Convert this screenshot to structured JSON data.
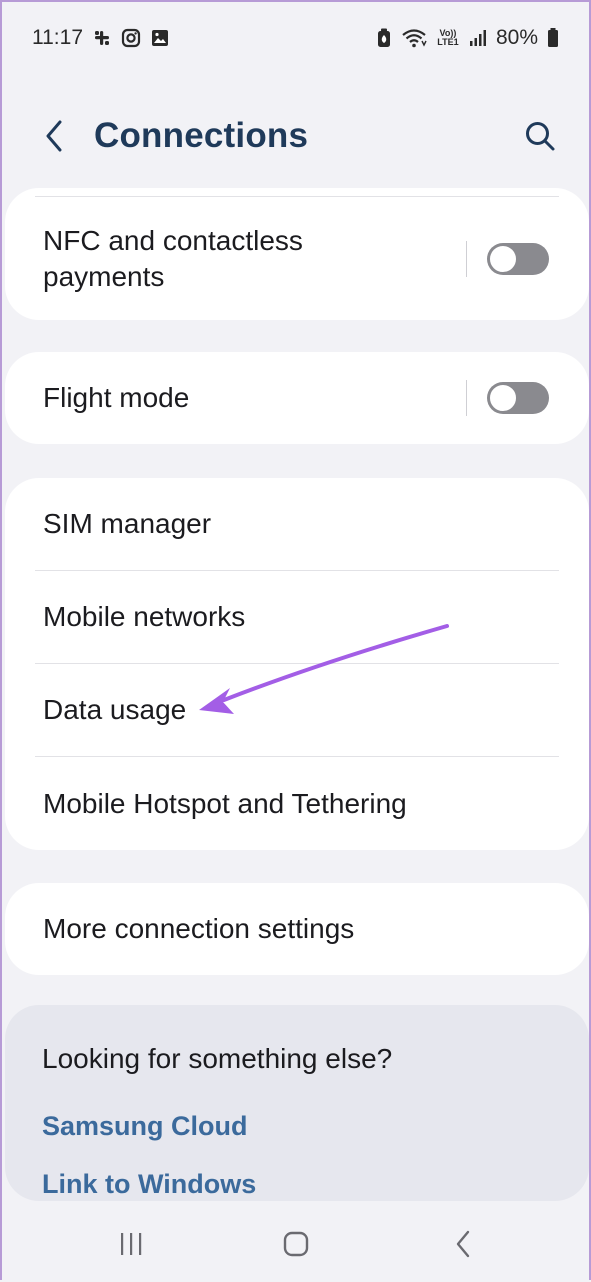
{
  "status_bar": {
    "time": "11:17",
    "left_icons": [
      "slack-icon",
      "instagram-icon",
      "gallery-icon"
    ],
    "right_icons": [
      "battery-saver-icon",
      "wifi-icon",
      "volte-lte-icon",
      "signal-icon"
    ],
    "volte_text": "Vo)) LTE1",
    "battery_percent": "80%"
  },
  "header": {
    "title": "Connections",
    "back_icon": "chevron-left-icon",
    "search_icon": "search-icon"
  },
  "cards": {
    "nfc": {
      "label": "NFC and contactless payments",
      "toggle_on": false
    },
    "flight_mode": {
      "label": "Flight mode",
      "toggle_on": false
    },
    "network_group": {
      "items": [
        {
          "label": "SIM manager"
        },
        {
          "label": "Mobile networks"
        },
        {
          "label": "Data usage"
        },
        {
          "label": "Mobile Hotspot and Tethering"
        }
      ]
    },
    "more": {
      "label": "More connection settings"
    }
  },
  "suggestions": {
    "title": "Looking for something else?",
    "links": [
      "Samsung Cloud",
      "Link to Windows"
    ]
  },
  "nav_bar": {
    "icons": [
      "recents-icon",
      "home-icon",
      "back-icon"
    ]
  },
  "colors": {
    "accent_title": "#1f3a5a",
    "link": "#3b6a9c",
    "annotation_arrow": "#a35ee6",
    "background": "#f2f2f6",
    "card": "#ffffff"
  }
}
